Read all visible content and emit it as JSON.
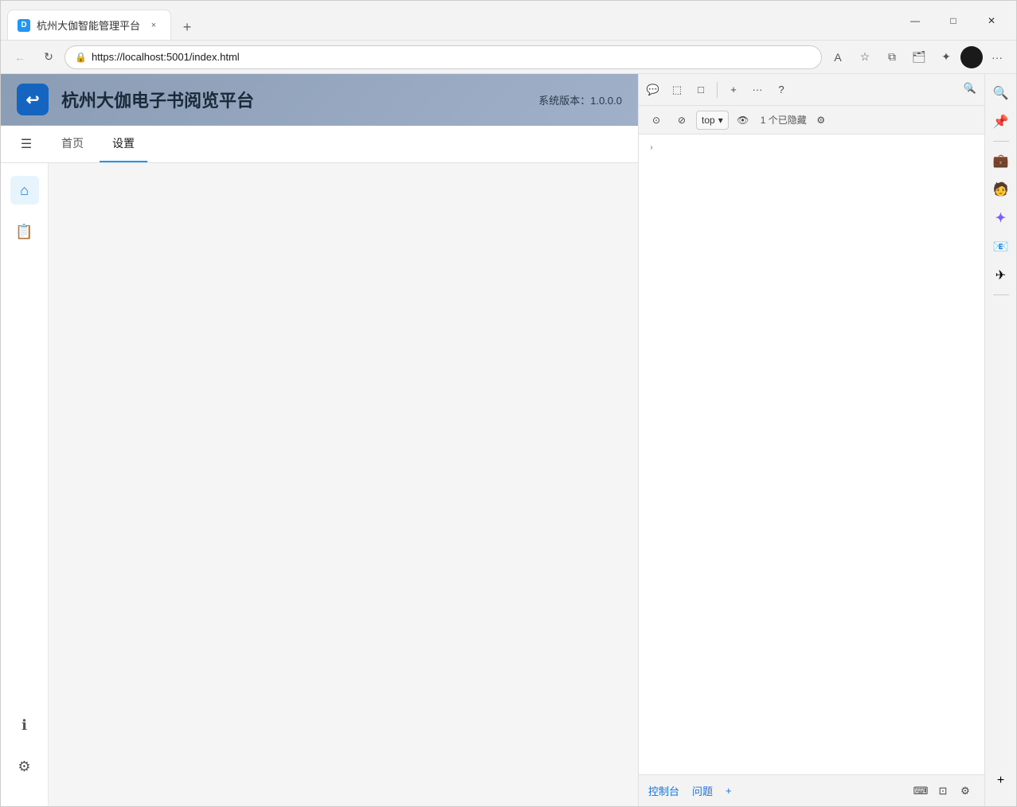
{
  "browser": {
    "tab_title": "杭州大伽智能管理平台",
    "tab_favicon_text": "D",
    "close_icon": "×",
    "new_tab_icon": "+",
    "window": {
      "minimize": "—",
      "maximize": "□",
      "close": "✕"
    },
    "url": "https://localhost:5001/index.html",
    "nav": {
      "back": "←",
      "refresh": "↻",
      "lock_icon": "🔒"
    }
  },
  "app": {
    "logo_text": "↩",
    "title": "杭州大伽电子书阅览平台",
    "version": "系统版本：1.0.0.0",
    "nav_tabs": [
      {
        "label": "首页",
        "active": false
      },
      {
        "label": "设置",
        "active": true
      }
    ],
    "sidebar_icons": [
      {
        "name": "home",
        "icon": "⌂"
      },
      {
        "name": "bookmark",
        "icon": "📋"
      }
    ],
    "sidebar_bottom_icons": [
      {
        "name": "info",
        "icon": "ℹ"
      },
      {
        "name": "settings",
        "icon": "⚙"
      }
    ]
  },
  "devtools": {
    "toolbar_icons": [
      {
        "name": "comment",
        "icon": "💬"
      },
      {
        "name": "inspect",
        "icon": "⬚"
      },
      {
        "name": "device",
        "icon": "□"
      },
      {
        "name": "add",
        "icon": "+"
      },
      {
        "name": "more",
        "icon": "···"
      },
      {
        "name": "help",
        "icon": "?"
      },
      {
        "name": "close",
        "icon": "×"
      }
    ],
    "search_icon": "🔍",
    "toolbar2_icons": [
      {
        "name": "record",
        "icon": "⊙"
      },
      {
        "name": "block",
        "icon": "⊘"
      },
      {
        "name": "settings-icon",
        "icon": "⚙"
      }
    ],
    "frame_label": "top",
    "frame_dropdown": "▾",
    "eye_icon": "👁",
    "hidden_count": "1 个已隐藏",
    "gear_icon": "⚙",
    "expand_arrow": "›",
    "bottom": {
      "console": "控制台",
      "issues": "问题",
      "add": "+",
      "icon1": "⌨",
      "icon2": "⊡",
      "icon3": "⚙"
    }
  },
  "ext_sidebar": {
    "icons": [
      {
        "name": "ext-magnify",
        "icon": "🔍"
      },
      {
        "name": "ext-pin",
        "icon": "📌"
      },
      {
        "name": "ext-briefcase",
        "icon": "💼"
      },
      {
        "name": "ext-figure",
        "icon": "🧑"
      },
      {
        "name": "ext-copilot",
        "icon": "✦"
      },
      {
        "name": "ext-outlook",
        "icon": "📧"
      },
      {
        "name": "ext-send",
        "icon": "✈"
      }
    ],
    "add_icon": "+"
  }
}
